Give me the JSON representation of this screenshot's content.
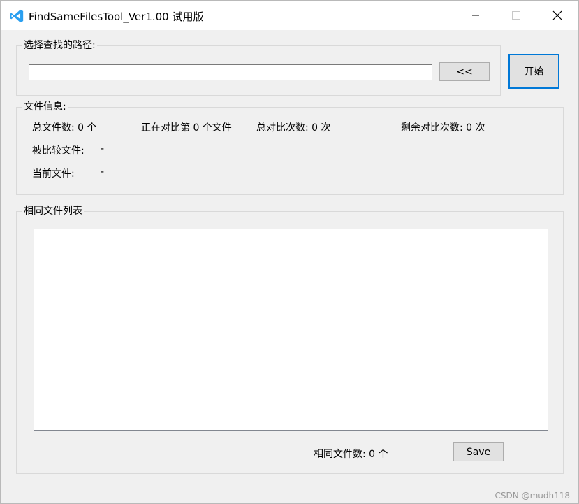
{
  "window": {
    "title": "FindSameFilesTool_Ver1.00 试用版",
    "controls": {
      "minimize": "—",
      "maximize": "☐",
      "close": "✕"
    }
  },
  "path_group": {
    "legend": "选择查找的路径:",
    "path_value": "",
    "browse_label": "<<",
    "start_label": "开始"
  },
  "info_group": {
    "legend": "文件信息:",
    "total_files": "总文件数:  0 个",
    "comparing": "正在对比第 0 个文件",
    "total_compare": "总对比次数:  0 次",
    "remaining": "剩余对比次数:  0 次",
    "compared_file_label": "被比较文件:",
    "compared_file_value": "-",
    "current_file_label": "当前文件:",
    "current_file_value": "-"
  },
  "list_group": {
    "legend": "相同文件列表",
    "count_text": "相同文件数:  0 个",
    "save_label": "Save"
  },
  "watermark": "CSDN @mudh118",
  "colors": {
    "accent": "#0078d7",
    "icon": "#2a9ff0"
  }
}
